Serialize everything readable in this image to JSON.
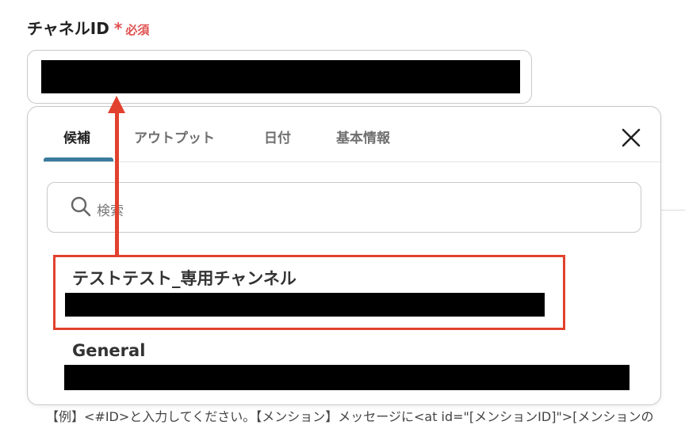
{
  "field": {
    "label": "チャネルID",
    "required_star": "*",
    "required_text": "必須"
  },
  "panel": {
    "tabs": [
      {
        "label": "候補",
        "active": true
      },
      {
        "label": "アウトプット",
        "active": false
      },
      {
        "label": "日付",
        "active": false
      },
      {
        "label": "基本情報",
        "active": false
      }
    ],
    "close_icon": "close-icon",
    "search": {
      "placeholder": "検索",
      "icon": "search-icon"
    },
    "options": [
      {
        "name": "テストテスト_専用チャンネル",
        "highlighted": true
      },
      {
        "name": "General",
        "highlighted": false
      }
    ]
  },
  "background": {
    "bottom_text": "【例】<#ID>と入力してください。【メンション】メッセージに<at id=\"[メンションID]\">[メンションの"
  },
  "colors": {
    "accent_tab": "#3b7b9e",
    "required": "#e0504f",
    "annotation": "#e1412e"
  }
}
